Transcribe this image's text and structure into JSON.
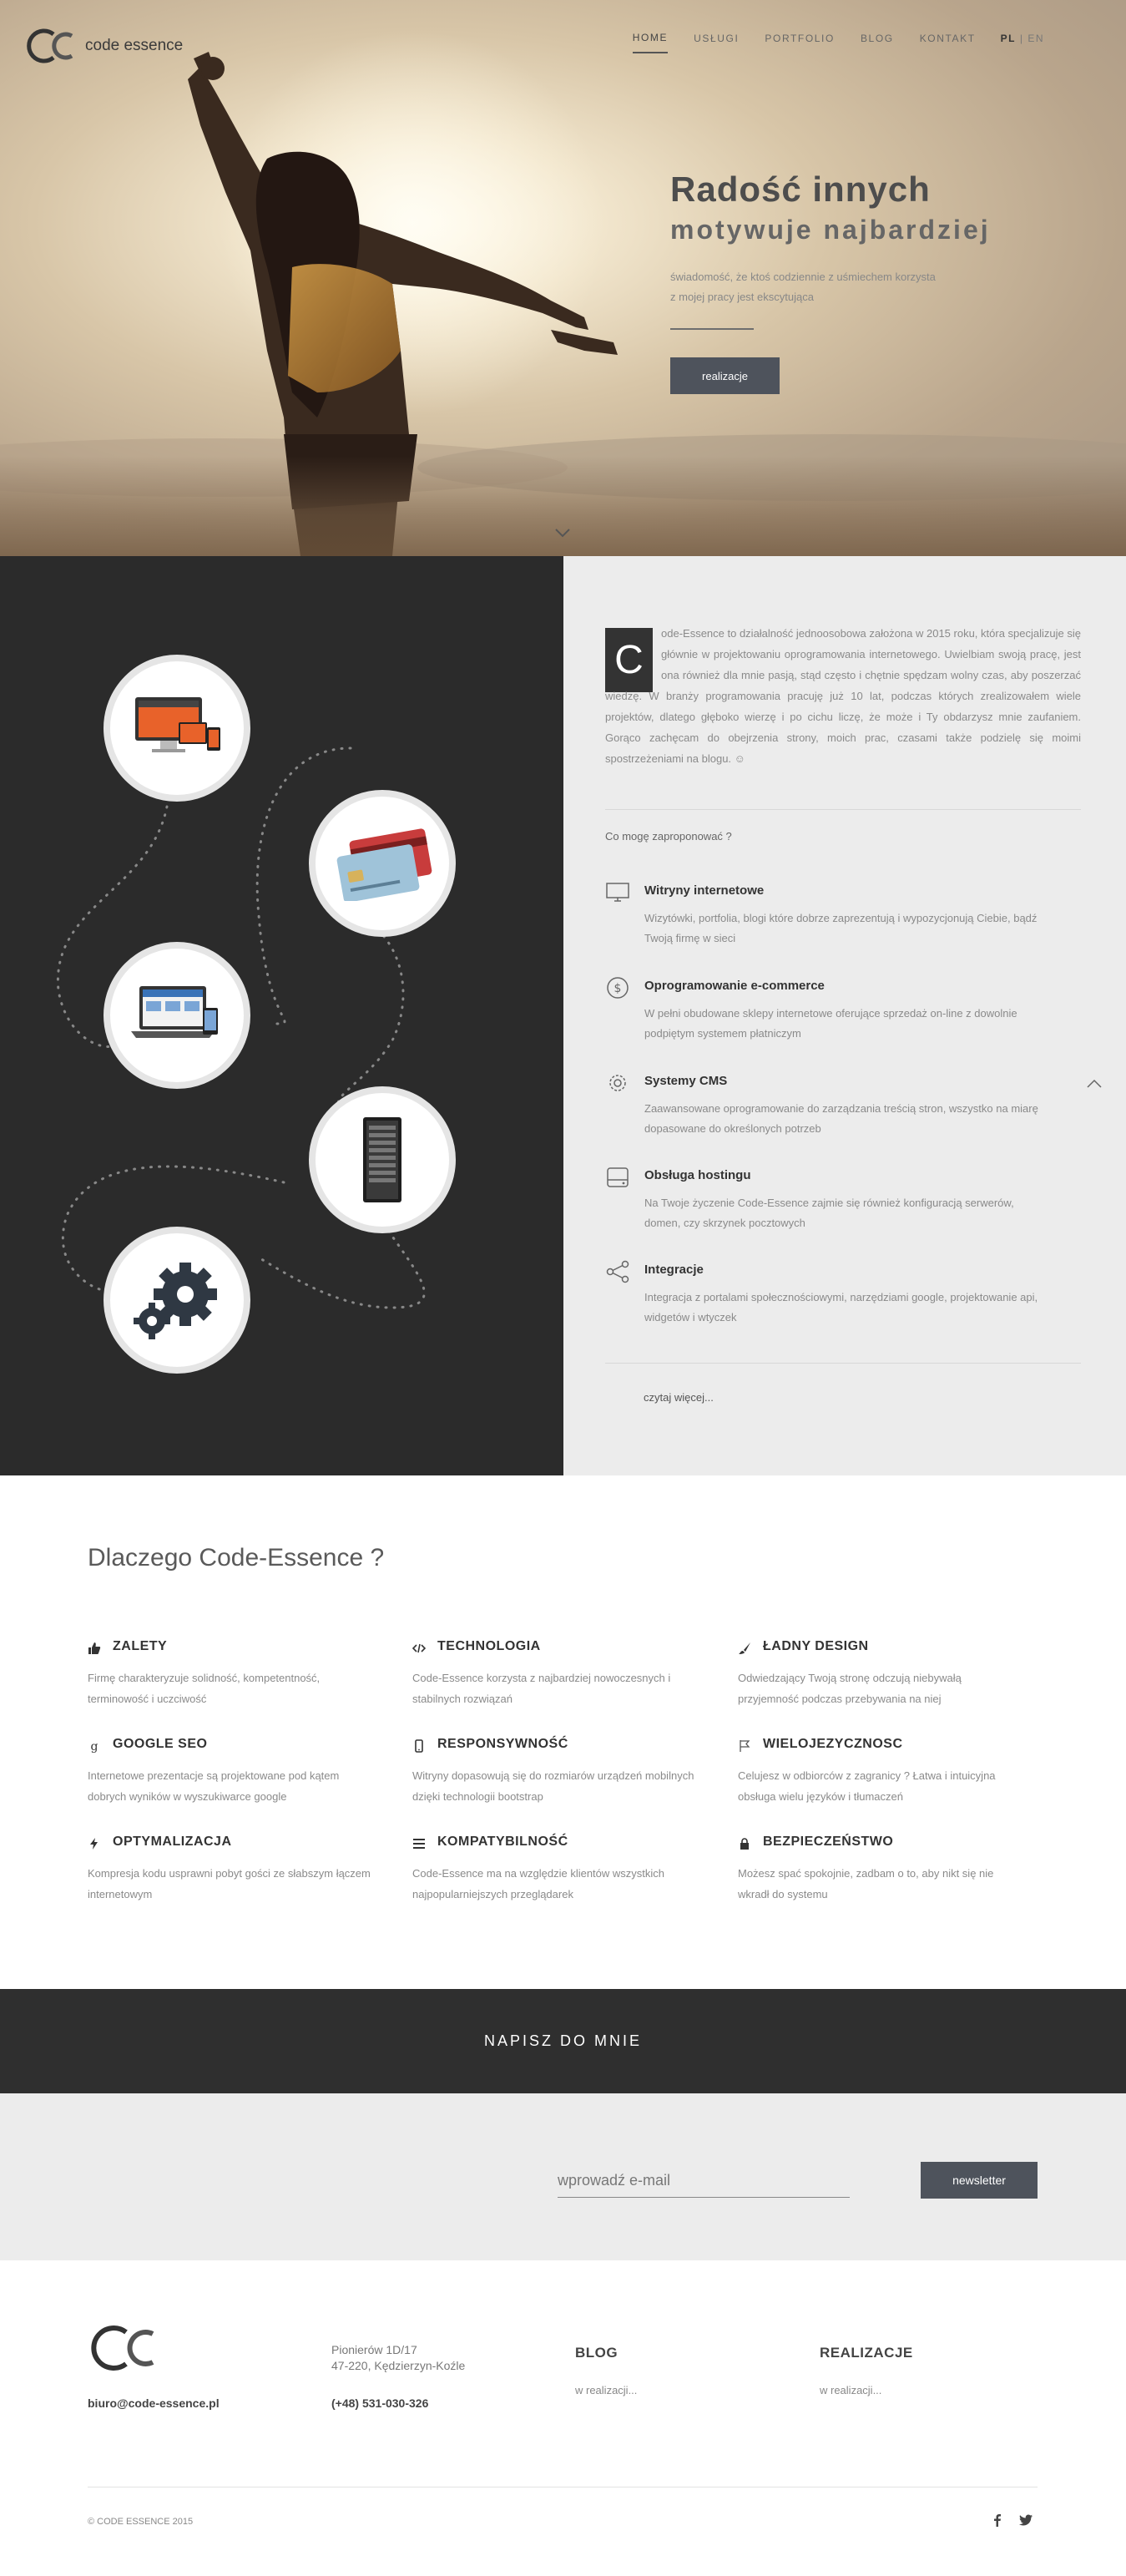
{
  "header": {
    "logo_text": "code essence",
    "nav": [
      "HOME",
      "USŁUGI",
      "PORTFOLIO",
      "BLOG",
      "KONTAKT"
    ],
    "lang_active": "PL",
    "lang_sep": "|",
    "lang_other": "EN"
  },
  "hero": {
    "title": "Radość innych",
    "subtitle": "motywuje najbardziej",
    "text": "świadomość, że ktoś codziennie z uśmiechem korzysta z mojej pracy jest ekscytująca",
    "button": "realizacje"
  },
  "about": {
    "dropcap": "C",
    "intro": "ode-Essence to działalność jednoosobowa założona w 2015 roku, która specjalizuje się głównie w projektowaniu oprogramowania internetowego. Uwielbiam swoją pracę, jest ona również dla mnie pasją, stąd często i chętnie spędzam wolny czas, aby poszerzać wiedzę. W branży programowania pracuję już 10 lat, podczas których zrealizowałem wiele projektów, dlatego głęboko wierzę i po cichu liczę, że może i Ty obdarzysz mnie zaufaniem. Gorąco zachęcam do obejrzenia strony, moich prac, czasami także podzielę się moimi spostrzeżeniami na blogu. ☺",
    "offer_question": "Co mogę zaproponować ?",
    "services": [
      {
        "title": "Witryny internetowe",
        "text": "Wizytówki, portfolia, blogi które dobrze zaprezentują i wypozycjonują Ciebie, bądź Twoją firmę w sieci",
        "icon": "monitor-icon"
      },
      {
        "title": "Oprogramowanie e-commerce",
        "text": "W pełni obudowane sklepy internetowe oferujące sprzedaż on-line z dowolnie podpiętym systemem płatniczym",
        "icon": "dollar-icon"
      },
      {
        "title": "Systemy CMS",
        "text": "Zaawansowane oprogramowanie do zarządzania treścią stron, wszystko na miarę dopasowane do określonych potrzeb",
        "icon": "gear-icon"
      },
      {
        "title": "Obsługa hostingu",
        "text": "Na Twoje życzenie Code-Essence zajmie się również konfiguracją serwerów, domen, czy skrzynek pocztowych",
        "icon": "hard-drive-icon"
      },
      {
        "title": "Integracje",
        "text": "Integracja z portalami społecznościowymi, narzędziami google, projektowanie api, widgetów i wtyczek",
        "icon": "share-icon"
      }
    ],
    "more": "czytaj więcej..."
  },
  "why": {
    "title": "Dlaczego Code-Essence ?",
    "features": [
      {
        "title": "ZALETY",
        "text": "Firmę charakteryzuje solidność, kompetentność, terminowość i uczciwość",
        "icon": "thumbs-up-icon"
      },
      {
        "title": "TECHNOLOGIA",
        "text": "Code-Essence korzysta z najbardziej nowoczesnych i stabilnych rozwiązań",
        "icon": "code-icon"
      },
      {
        "title": "ŁADNY DESIGN",
        "text": "Odwiedzający Twoją stronę odczują niebywałą przyjemność podczas przebywania na niej",
        "icon": "brush-icon"
      },
      {
        "title": "GOOGLE SEO",
        "text": "Internetowe prezentacje są projektowane pod kątem dobrych wyników w wyszukiwarce google",
        "icon": "google-icon"
      },
      {
        "title": "RESPONSYWNOŚĆ",
        "text": "Witryny dopasowują się do rozmiarów urządzeń mobilnych dzięki technologii bootstrap",
        "icon": "mobile-icon"
      },
      {
        "title": "WIELOJEZYCZNOSC",
        "text": "Celujesz w odbiorców z zagranicy ? Łatwa i intuicyjna obsługa wielu języków i tłumaczeń",
        "icon": "flag-icon"
      },
      {
        "title": "OPTYMALIZACJA",
        "text": "Kompresja kodu usprawni pobyt gości ze słabszym łączem internetowym",
        "icon": "bolt-icon"
      },
      {
        "title": "KOMPATYBILNOŚĆ",
        "text": "Code-Essence ma na względzie klientów wszystkich najpopularniejszych przeglądarek",
        "icon": "list-icon"
      },
      {
        "title": "BEZPIECZEŃSTWO",
        "text": "Możesz spać spokojnie, zadbam o to, aby nikt się nie wkradł do systemu",
        "icon": "lock-icon"
      }
    ]
  },
  "contact": {
    "title": "NAPISZ DO MNIE"
  },
  "newsletter": {
    "placeholder": "wprowadź e-mail",
    "button": "newsletter"
  },
  "footer": {
    "email": "biuro@code-essence.pl",
    "address_line1": "Pionierów 1D/17",
    "address_line2": "47-220, Kędzierzyn-Koźle",
    "phone": "(+48) 531-030-326",
    "blog_title": "BLOG",
    "blog_link": "w realizacji...",
    "realizacje_title": "REALIZACJE",
    "realizacje_link": "w realizacji...",
    "copyright": "© CODE ESSENCE 2015"
  }
}
